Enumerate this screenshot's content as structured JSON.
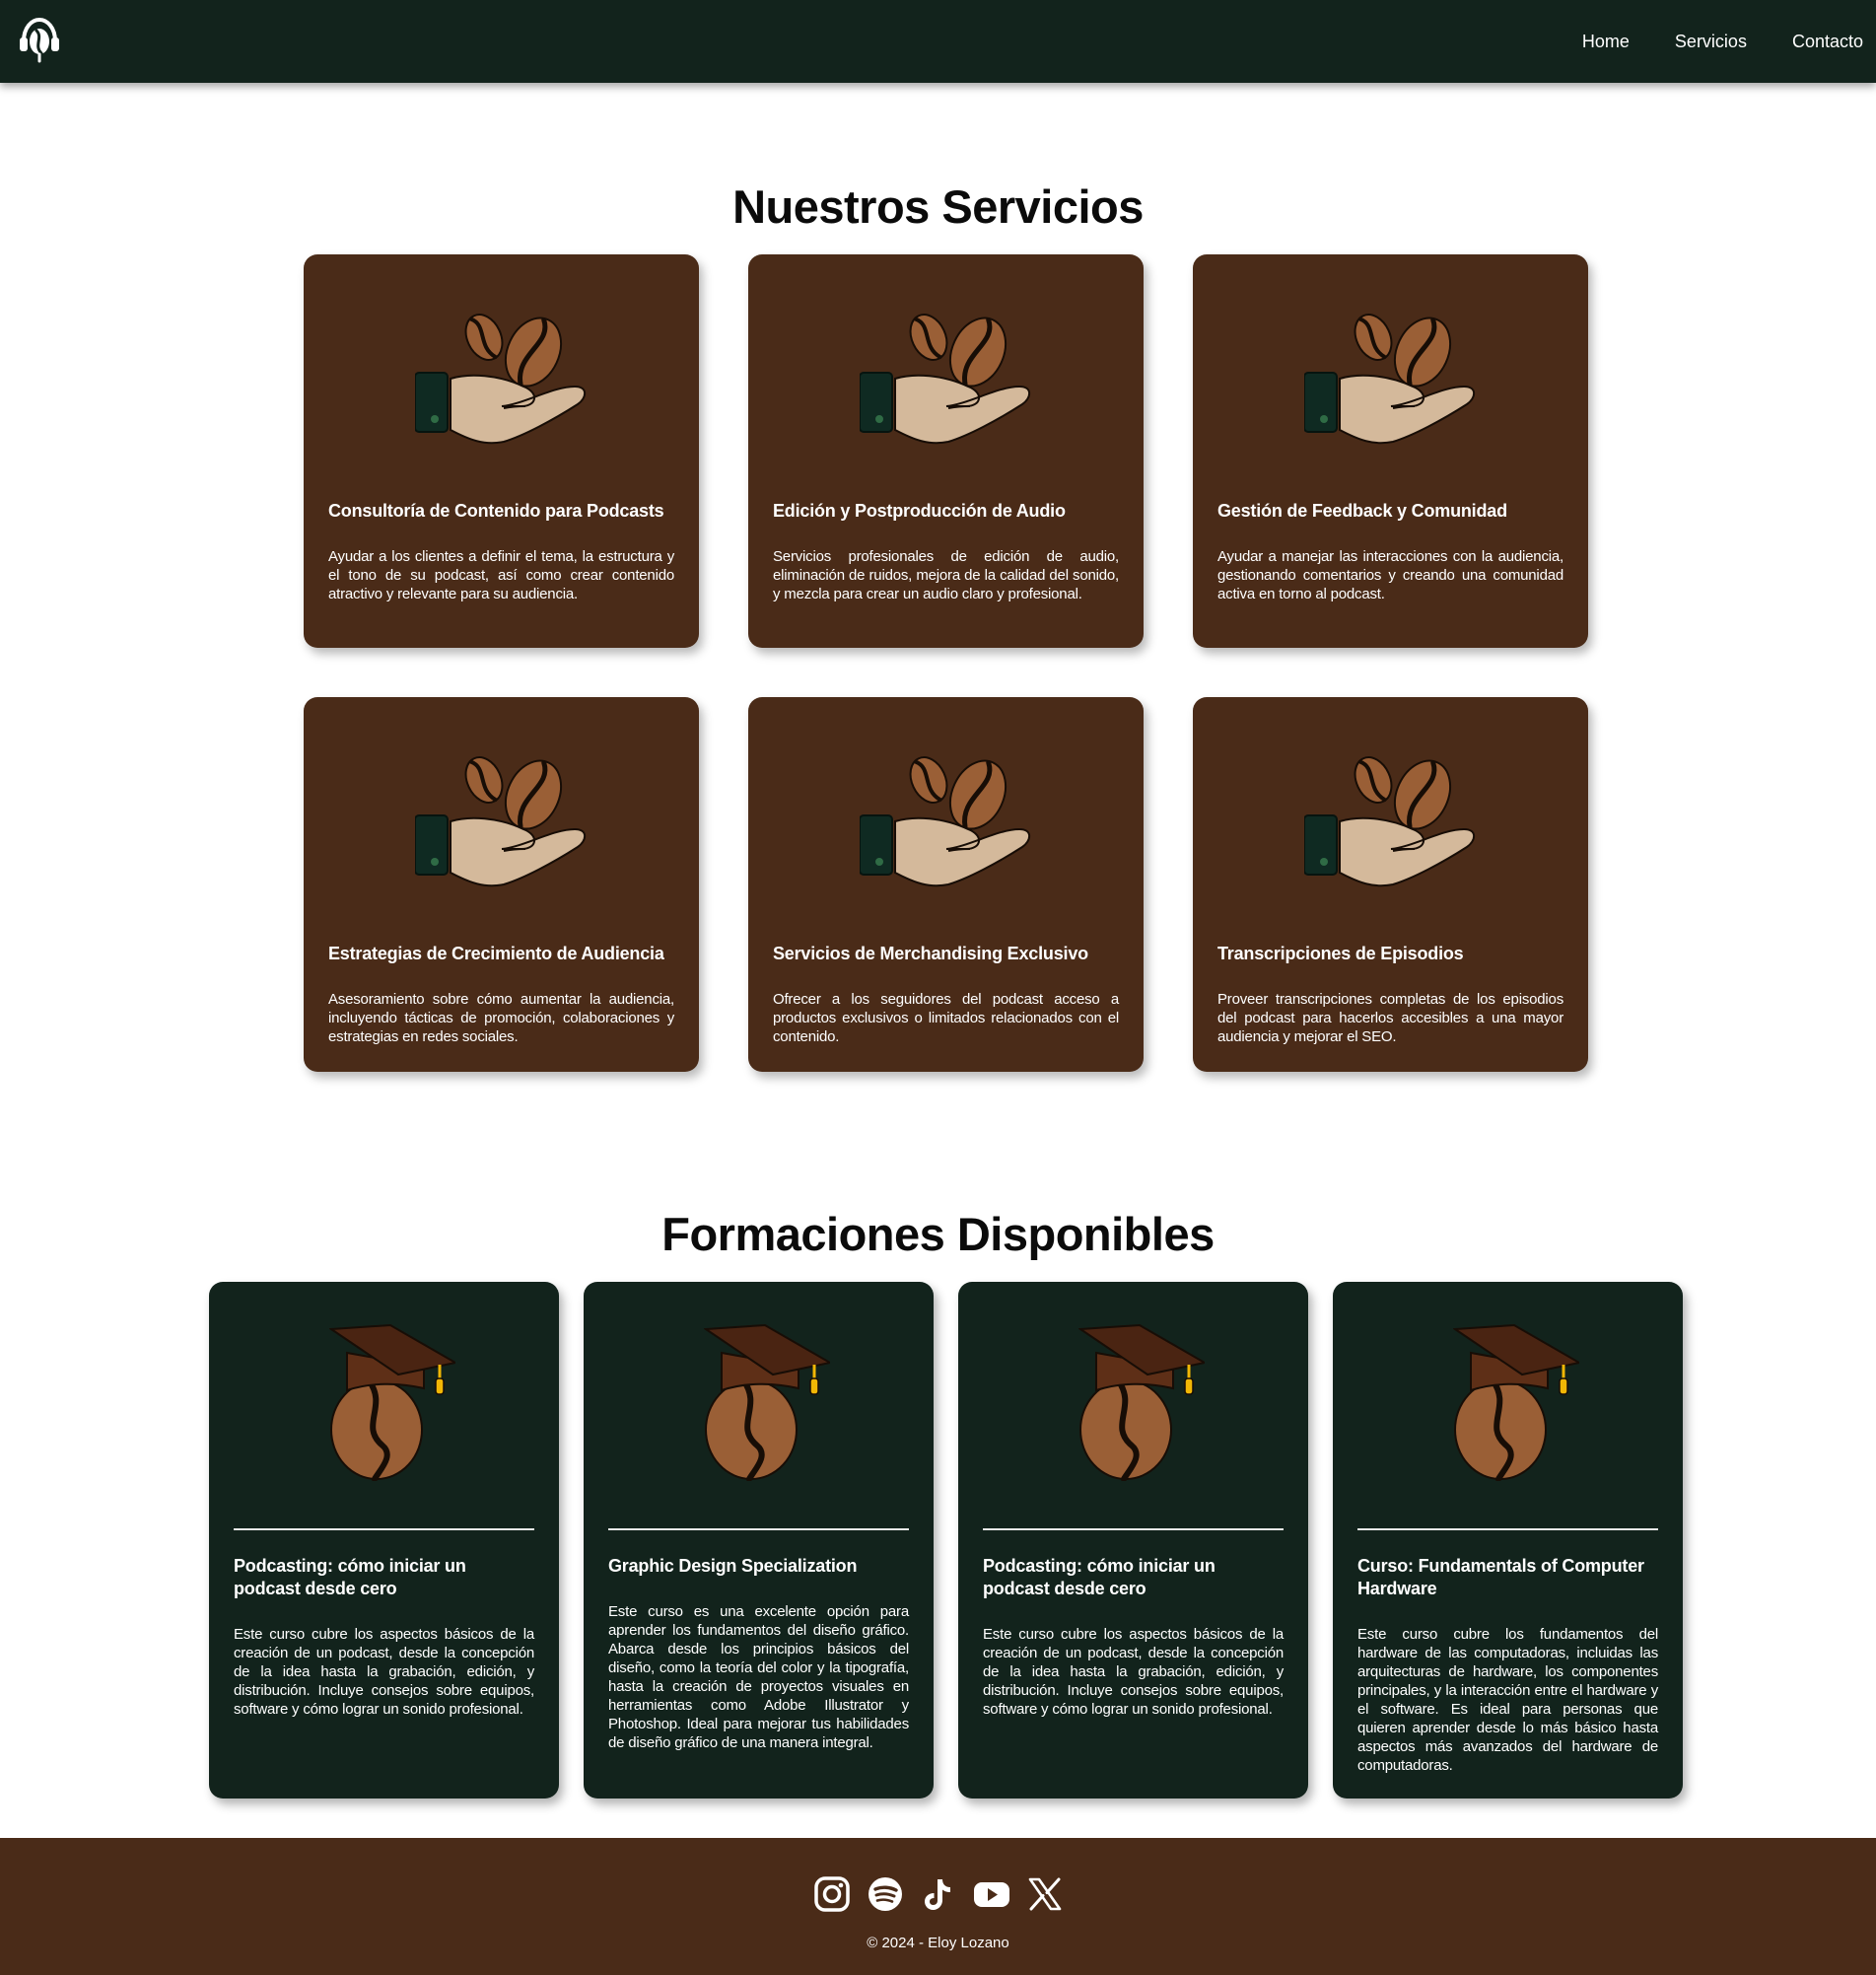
{
  "header": {
    "logo_icon": "podcast-headphones-logo",
    "nav": [
      {
        "label": "Home"
      },
      {
        "label": "Servicios"
      },
      {
        "label": "Contacto"
      }
    ]
  },
  "services": {
    "title": "Nuestros Servicios",
    "icon": "hand-coffee-beans-icon",
    "items": [
      {
        "title": "Consultoría de Contenido para Podcasts",
        "description": "Ayudar a los clientes a definir el tema, la estructura y el tono de su podcast, así como crear contenido atractivo y relevante para su audiencia."
      },
      {
        "title": "Edición y Postproducción de Audio",
        "description": "Servicios profesionales de edición de audio, eliminación de ruidos, mejora de la calidad del sonido, y mezcla para crear un audio claro y profesional."
      },
      {
        "title": "Gestión de Feedback y Comunidad",
        "description": "Ayudar a manejar las interacciones con la audiencia, gestionando comentarios y creando una comunidad activa en torno al podcast."
      },
      {
        "title": "Estrategias de Crecimiento de Audiencia",
        "description": "Asesoramiento sobre cómo aumentar la audiencia, incluyendo tácticas de promoción, colaboraciones y estrategias en redes sociales."
      },
      {
        "title": "Servicios de Merchandising Exclusivo",
        "description": "Ofrecer a los seguidores del podcast acceso a productos exclusivos o limitados relacionados con el contenido."
      },
      {
        "title": "Transcripciones de Episodios",
        "description": "Proveer transcripciones completas de los episodios del podcast para hacerlos accesibles a una mayor audiencia y mejorar el SEO."
      }
    ]
  },
  "courses": {
    "title": "Formaciones Disponibles",
    "icon": "graduation-cap-coffee-bean-icon",
    "items": [
      {
        "title": "Podcasting: cómo iniciar un podcast desde cero",
        "description": "Este curso cubre los aspectos básicos de la creación de un podcast, desde la concepción de la idea hasta la grabación, edición, y distribución. Incluye consejos sobre equipos, software y cómo lograr un sonido profesional."
      },
      {
        "title": "Graphic Design Specialization",
        "description": "Este curso es una excelente opción para aprender los fundamentos del diseño gráfico. Abarca desde los principios básicos del diseño, como la teoría del color y la tipografía, hasta la creación de proyectos visuales en herramientas como Adobe Illustrator y Photoshop. Ideal para mejorar tus habilidades de diseño gráfico de una manera integral."
      },
      {
        "title": "Podcasting: cómo iniciar un podcast desde cero",
        "description": "Este curso cubre los aspectos básicos de la creación de un podcast, desde la concepción de la idea hasta la grabación, edición, y distribución. Incluye consejos sobre equipos, software y cómo lograr un sonido profesional."
      },
      {
        "title": "Curso: Fundamentals of Computer Hardware",
        "description": "Este curso cubre los fundamentos del hardware de las computadoras, incluidas las arquitecturas de hardware, los componentes principales, y la interacción entre el hardware y el software. Es ideal para personas que quieren aprender desde lo más básico hasta aspectos más avanzados del hardware de computadoras."
      }
    ]
  },
  "footer": {
    "socials": [
      "instagram-icon",
      "spotify-icon",
      "tiktok-icon",
      "youtube-icon",
      "x-icon"
    ],
    "copyright": "© 2024 - Eloy Lozano"
  },
  "colors": {
    "header_bg": "#12231c",
    "service_card_bg": "#4a2b18",
    "course_card_bg": "#12231c",
    "footer_bg": "#4a2b18",
    "bean": "#9a5f36",
    "hand": "#d4b99b",
    "tassel": "#f2b705"
  }
}
